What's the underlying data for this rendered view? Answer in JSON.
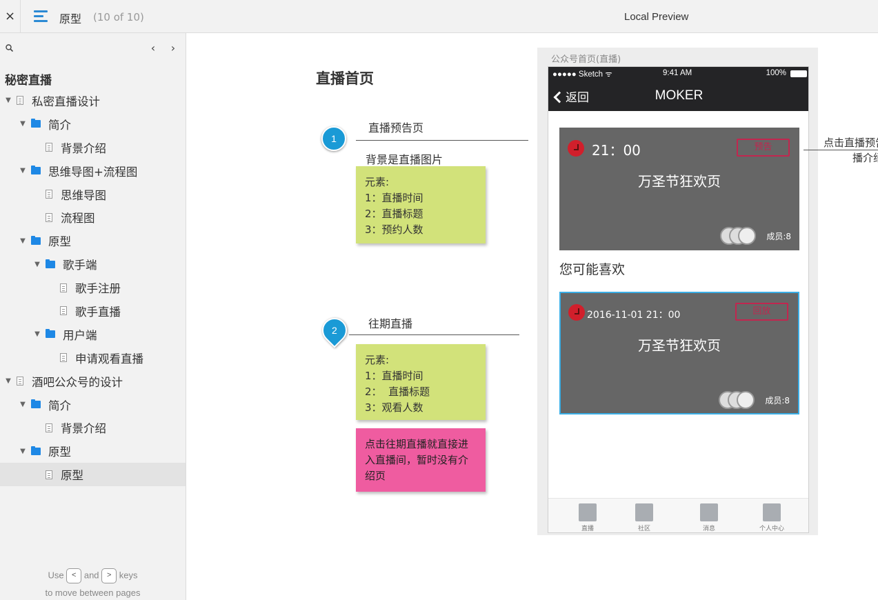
{
  "topbar": {
    "close_glyph": "×",
    "page_name": "原型",
    "page_count": "(10 of 10)",
    "preview_title": "Local Preview"
  },
  "sidebar": {
    "project_title": "秘密直播",
    "nav_prev": "‹",
    "nav_next": "›",
    "tree": [
      {
        "label": "私密直播设计",
        "type": "page",
        "level": 0,
        "expanded": true
      },
      {
        "label": "简介",
        "type": "folder",
        "level": 1,
        "expanded": true
      },
      {
        "label": "背景介绍",
        "type": "page",
        "level": 2
      },
      {
        "label": "思维导图+流程图",
        "type": "folder",
        "level": 1,
        "expanded": true
      },
      {
        "label": "思维导图",
        "type": "page",
        "level": 2
      },
      {
        "label": "流程图",
        "type": "page",
        "level": 2
      },
      {
        "label": "原型",
        "type": "folder",
        "level": 1,
        "expanded": true
      },
      {
        "label": "歌手端",
        "type": "folder",
        "level": 2,
        "expanded": true
      },
      {
        "label": "歌手注册",
        "type": "page",
        "level": 3
      },
      {
        "label": "歌手直播",
        "type": "page",
        "level": 3
      },
      {
        "label": "用户端",
        "type": "folder",
        "level": 2,
        "expanded": true
      },
      {
        "label": "申请观看直播",
        "type": "page",
        "level": 3
      },
      {
        "label": "酒吧公众号的设计",
        "type": "page",
        "level": 0,
        "expanded": true
      },
      {
        "label": "简介",
        "type": "folder",
        "level": 1,
        "expanded": true
      },
      {
        "label": "背景介绍",
        "type": "page",
        "level": 2
      },
      {
        "label": "原型",
        "type": "folder",
        "level": 1,
        "expanded": true
      },
      {
        "label": "原型",
        "type": "page",
        "level": 2,
        "active": true
      }
    ],
    "hint": {
      "use": "Use",
      "key_prev": "<",
      "and": "and",
      "key_next": ">",
      "keys": "keys",
      "line2": "to move between pages"
    }
  },
  "canvas": {
    "title": "直播首页",
    "note1": {
      "marker": "1",
      "label": "直播预告页",
      "sublabel": "背景是直播图片",
      "sticky_lines": [
        "元素:",
        "1：直播时间",
        "2：直播标题",
        "3：预约人数"
      ]
    },
    "note2": {
      "marker": "2",
      "label": "往期直播",
      "sticky_lines": [
        "元素:",
        "1：直播时间",
        "2：  直播标题",
        "3：观看人数"
      ],
      "pink_lines": [
        "点击往期直播就直接进",
        "入直播间，暂时没有介",
        "绍页"
      ]
    },
    "side_note_lines": [
      "点击直播预告",
      "播介绍"
    ]
  },
  "phone": {
    "label": "公众号首页(直播)",
    "status": {
      "carrier": "●●●●● Sketch ᯤ",
      "time": "9:41 AM",
      "battery": "100%"
    },
    "nav": {
      "back": "返回",
      "title": "MOKER"
    },
    "card1": {
      "time": "21：00",
      "tag": "预告",
      "title": "万圣节狂欢页",
      "members": "成员:8"
    },
    "section_title": "您可能喜欢",
    "card2": {
      "time": "2016-11-01 21：00",
      "tag": "回放",
      "title": "万圣节狂欢页",
      "members": "成员:8"
    },
    "tabs": [
      "直播",
      "社区",
      "消息",
      "个人中心"
    ]
  },
  "colors": {
    "accent": "#1a9ad6",
    "folder": "#1e88e5",
    "sticky_green": "#d2e27a",
    "sticky_pink": "#ef5ca0",
    "phone_header": "#242426",
    "card_bg": "#666666",
    "tag_red": "#c2264f"
  },
  "icons": {
    "close": "close-icon",
    "menu": "menu-icon",
    "search": "search-icon",
    "folder": "folder-icon",
    "page": "page-icon",
    "caret": "caret-down-icon"
  }
}
